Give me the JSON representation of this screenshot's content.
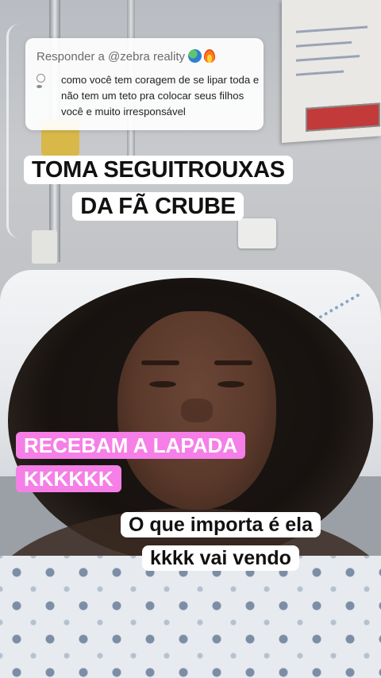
{
  "reply": {
    "header_prefix": "Responder a @zebra reality",
    "header_emojis": [
      "globe-icon",
      "fire-icon"
    ],
    "comment": "como você tem coragem de se lipar toda e não tem um teto pra colocar seus filhos você e muito irresponsável"
  },
  "captions": {
    "top": "TOMA SEGUITROUXAS DA FÃ CRUBE",
    "middle": "RECEBAM A LAPADA KKKKKK",
    "bottom": "O que importa é ela kkkk vai vendo"
  },
  "colors": {
    "pink_caption": "#f57fe7",
    "white_caption": "#ffffff",
    "reply_card": "#ffffff"
  }
}
